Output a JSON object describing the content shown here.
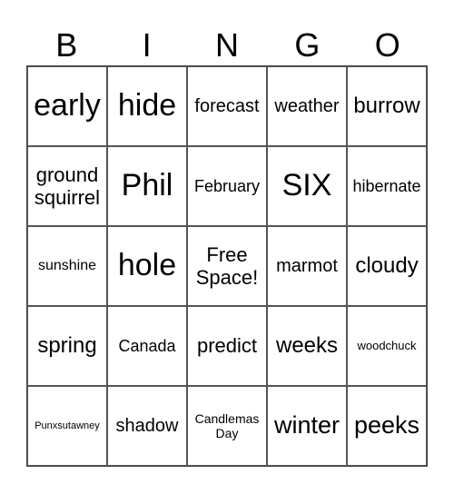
{
  "card": {
    "header": [
      "B",
      "I",
      "N",
      "G",
      "O"
    ],
    "rows": [
      [
        "early",
        "hide",
        "forecast",
        "weather",
        "burrow"
      ],
      [
        "ground squirrel",
        "Phil",
        "February",
        "SIX",
        "hibernate"
      ],
      [
        "sunshine",
        "hole",
        "Free Space!",
        "marmot",
        "cloudy"
      ],
      [
        "spring",
        "Canada",
        "predict",
        "weeks",
        "woodchuck"
      ],
      [
        "Punxsutawney",
        "shadow",
        "Candlemas Day",
        "winter",
        "peeks"
      ]
    ]
  }
}
